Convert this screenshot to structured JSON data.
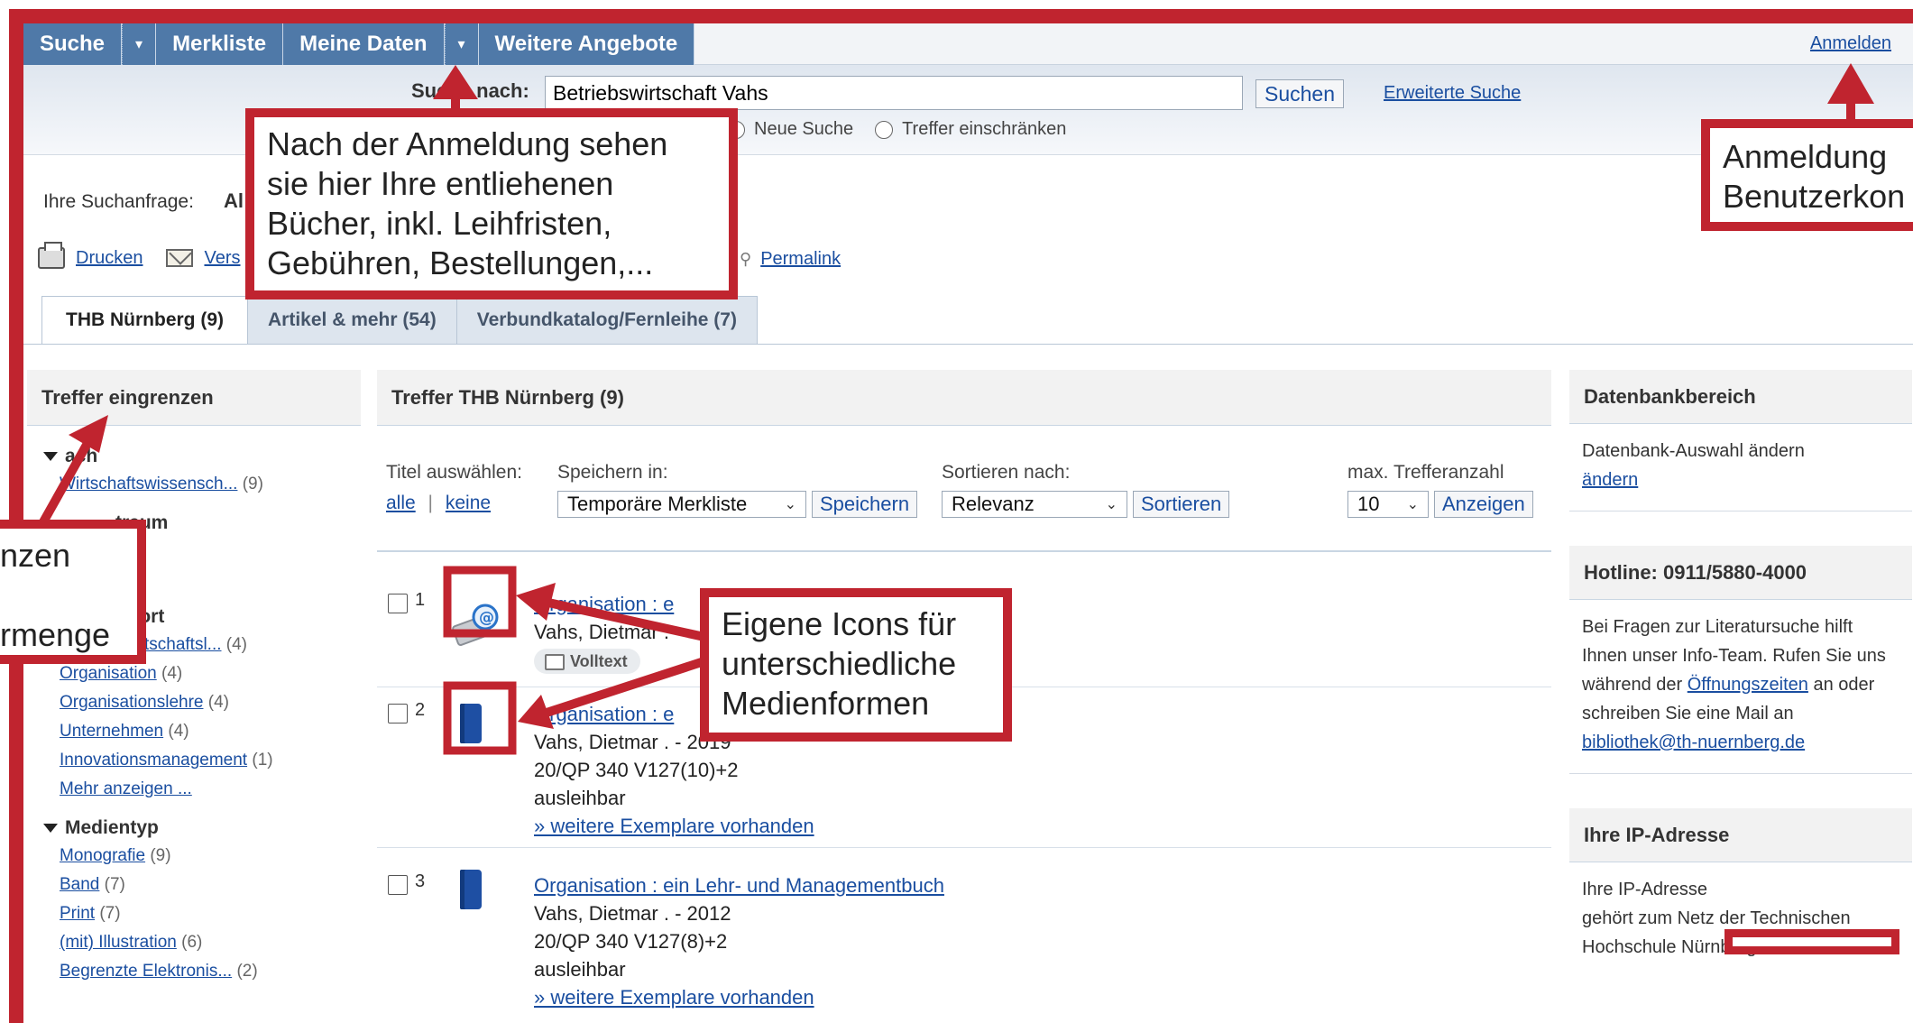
{
  "nav": {
    "items": [
      "Suche",
      "Merkliste",
      "Meine Daten",
      "Weitere Angebote"
    ],
    "login": "Anmelden"
  },
  "search": {
    "label": "Suche nach:",
    "query": "Betriebswirtschaft Vahs",
    "button": "Suchen",
    "advanced": "Erweiterte Suche",
    "radio_new": "Neue Suche",
    "radio_restrict": "Treffer einschränken"
  },
  "query_line": {
    "label": "Ihre Suchanfrage:",
    "value": "Al"
  },
  "actions": {
    "print": "Drucken",
    "send": "Vers",
    "permalink": "Permalink"
  },
  "tabs": [
    "THB Nürnberg (9)",
    "Artikel & mehr (54)",
    "Verbundkatalog/Fernleihe (7)"
  ],
  "left": {
    "title": "Treffer eingrenzen",
    "facets": [
      {
        "title": "ach",
        "items": [
          {
            "label": "Wirtschaftswissensch...",
            "count": "(9)"
          }
        ]
      },
      {
        "title": "traum",
        "items": []
      },
      {
        "title": "wort",
        "items": [
          {
            "label": "Betriebswirtschaftsl...",
            "count": "(4)"
          },
          {
            "label": "Organisation",
            "count": "(4)"
          },
          {
            "label": "Organisationslehre",
            "count": "(4)"
          },
          {
            "label": "Unternehmen",
            "count": "(4)"
          },
          {
            "label": "Innovationsmanagement",
            "count": "(1)"
          },
          {
            "label": "Mehr anzeigen ...",
            "count": ""
          }
        ]
      },
      {
        "title": "Medientyp",
        "items": [
          {
            "label": "Monografie",
            "count": "(9)"
          },
          {
            "label": "Band",
            "count": "(7)"
          },
          {
            "label": "Print",
            "count": "(7)"
          },
          {
            "label": "(mit) Illustration",
            "count": "(6)"
          },
          {
            "label": "Begrenzte Elektronis...",
            "count": "(2)"
          }
        ]
      }
    ]
  },
  "center": {
    "title": "Treffer THB Nürnberg (9)",
    "select_title": "Titel auswählen:",
    "select_all": "alle",
    "select_none": "keine",
    "save_label": "Speichern in:",
    "save_option": "Temporäre Merkliste",
    "save_button": "Speichern",
    "sort_label": "Sortieren nach:",
    "sort_option": "Relevanz",
    "sort_button": "Sortieren",
    "max_label": "max. Trefferanzahl",
    "max_option": "10",
    "max_button": "Anzeigen",
    "results": [
      {
        "num": "1",
        "title": "Organisation : e",
        "author": "Vahs, Dietmar . -",
        "badge": "Volltext"
      },
      {
        "num": "2",
        "title": "Organisation : e",
        "author": "Vahs, Dietmar . - 2019",
        "sig": "20/QP 340 V127(10)+2",
        "status": "ausleihbar",
        "more": "» weitere Exemplare vorhanden"
      },
      {
        "num": "3",
        "title": "Organisation : ein Lehr- und Managementbuch",
        "author": "Vahs, Dietmar . - 2012",
        "sig": "20/QP 340 V127(8)+2",
        "status": "ausleihbar",
        "more": "» weitere Exemplare vorhanden"
      }
    ]
  },
  "right": {
    "db_title": "Datenbankbereich",
    "db_text": "Datenbank-Auswahl ändern",
    "db_link": "ändern",
    "hotline_title": "Hotline: 0911/5880-4000",
    "hotline_text1": "Bei Fragen zur Literatursuche hilft Ihnen unser Info-Team. Rufen Sie uns während der",
    "hotline_link1": "Öffnungszeiten",
    "hotline_text2": "an oder schreiben Sie eine Mail an",
    "hotline_link2": "bibliothek@th-nuernberg.de",
    "ip_title": "Ihre IP-Adresse",
    "ip_text1": "Ihre IP-Adresse",
    "ip_text2": "gehört zum Netz der Technischen Hochschule Nürnberg. Sie"
  },
  "callouts": {
    "meine_daten": "Nach der Anmeldung sehen\nsie hier Ihre entliehenen\nBücher, inkl. Leihfristen,\nGebühren, Bestellungen,...",
    "anmeldung": "Anmeldung\nBenutzerkon",
    "eingrenzen": "nzen\n\nrmenge",
    "icons": "Eigene Icons für\nunterschiedliche\nMedienformen"
  },
  "colors": {
    "accent_red": "#c0242f",
    "nav_blue": "#4f79a8",
    "link_blue": "#1a4ea0",
    "book_blue": "#1e4fa3"
  }
}
